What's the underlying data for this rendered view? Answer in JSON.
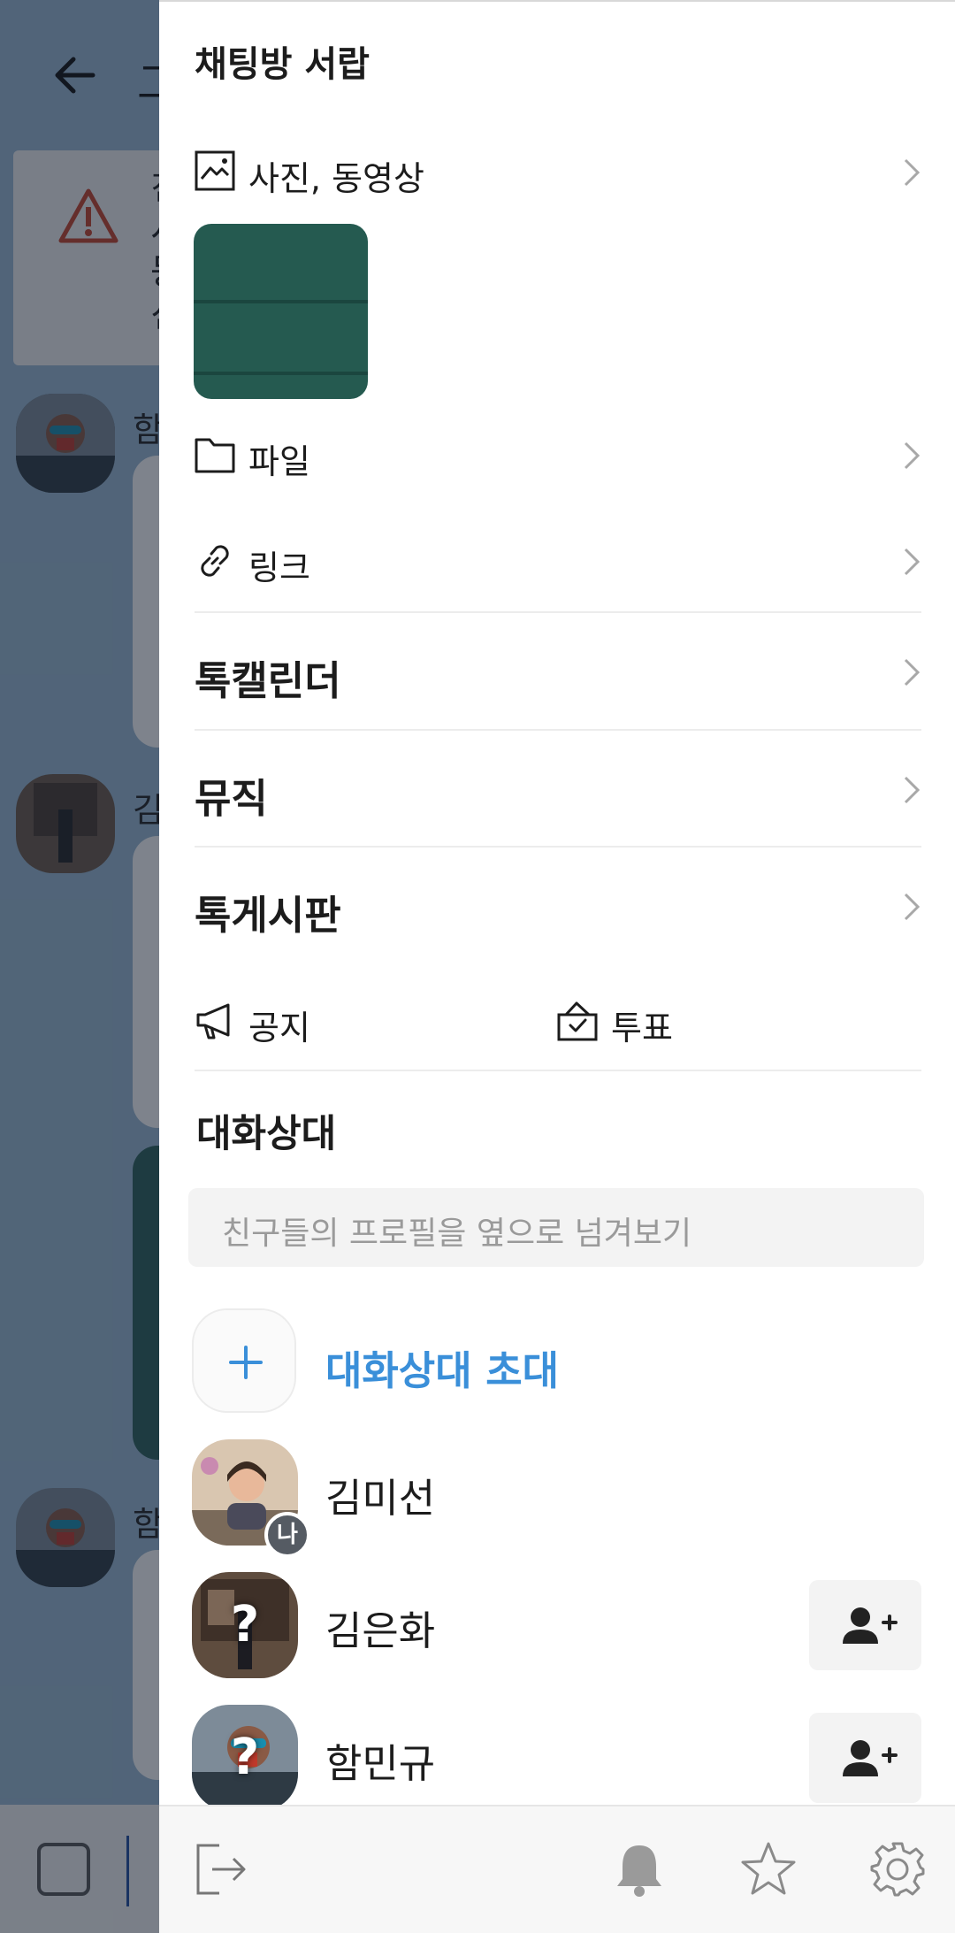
{
  "background": {
    "title": "그",
    "warning_lines": [
      "친",
      "시",
      "등",
      "신"
    ],
    "sender_names": [
      "함",
      "김",
      "함"
    ]
  },
  "drawer": {
    "title": "채팅방 서랍",
    "media": {
      "label": "사진, 동영상",
      "icon": "image-icon"
    },
    "files": {
      "label": "파일",
      "icon": "folder-icon"
    },
    "links": {
      "label": "링크",
      "icon": "link-icon"
    },
    "menu": [
      {
        "label": "톡캘린더"
      },
      {
        "label": "뮤직"
      },
      {
        "label": "톡게시판"
      }
    ],
    "notice": {
      "label": "공지",
      "icon": "megaphone-icon"
    },
    "poll": {
      "label": "투표",
      "icon": "ballot-box-icon"
    },
    "participants": {
      "title": "대화상대",
      "search_placeholder": "친구들의 프로필을 옆으로 넘겨보기",
      "invite_label": "대화상대 초대",
      "members": [
        {
          "name": "김미선",
          "badge": "나"
        },
        {
          "name": "김은화",
          "badge": "?"
        },
        {
          "name": "함민규",
          "badge": "?"
        }
      ]
    },
    "bottom_icons": [
      "exit-icon",
      "bell-icon",
      "star-icon",
      "settings-icon"
    ]
  }
}
